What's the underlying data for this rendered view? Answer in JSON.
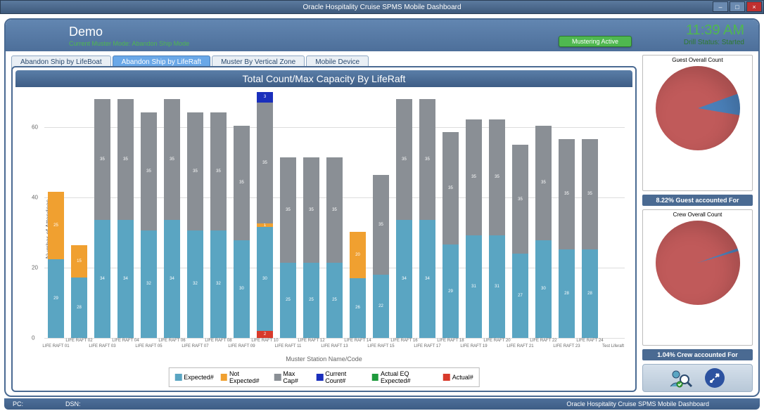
{
  "window": {
    "title": "Oracle Hospitality Cruise SPMS Mobile Dashboard"
  },
  "header": {
    "title": "Demo",
    "muster_mode": "Current Muster Mode: Abandon Ship Mode",
    "mustering_badge": "Mustering Active",
    "clock": "11:39 AM",
    "drill_status": "Drill Status: Started"
  },
  "tabs": [
    {
      "label": "Abandon Ship by LifeBoat",
      "active": false
    },
    {
      "label": "Abandon Ship by LifeRaft",
      "active": true
    },
    {
      "label": "Muster By Vertical Zone",
      "active": false
    },
    {
      "label": "Mobile Device",
      "active": false
    }
  ],
  "chart_data": {
    "type": "bar",
    "title": "Total Count/Max Capacity By LifeRaft",
    "xlabel": "Muster Station Name/Code",
    "ylabel": "Number of Attendees",
    "ylim": [
      0,
      70
    ],
    "y_ticks": [
      0,
      20,
      40,
      60
    ],
    "categories": [
      "LIFE RAFT 01",
      "LIFE RAFT 02",
      "LIFE RAFT 03",
      "LIFE RAFT 04",
      "LIFE RAFT 05",
      "LIFE RAFT 06",
      "LIFE RAFT 07",
      "LIFE RAFT 08",
      "LIFE RAFT 09",
      "LIFE RAFT 10",
      "LIFE RAFT 11",
      "LIFE RAFT 12",
      "LIFE RAFT 13",
      "LIFE RAFT 14",
      "LIFE RAFT 15",
      "LIFE RAFT 16",
      "LIFE RAFT 17",
      "LIFE RAFT 18",
      "LIFE RAFT 19",
      "LIFE RAFT 20",
      "LIFE RAFT 21",
      "LIFE RAFT 22",
      "LIFE RAFT 23",
      "LIFE RAFT 24",
      "Test Liferaft"
    ],
    "series": [
      {
        "name": "Expected#",
        "color": "#5aa5c2",
        "values": [
          29,
          28,
          34,
          34,
          32,
          34,
          32,
          32,
          30,
          30,
          25,
          25,
          25,
          26,
          22,
          34,
          34,
          29,
          31,
          31,
          27,
          30,
          28,
          28,
          0
        ]
      },
      {
        "name": "Not Expected#",
        "color": "#f0a030",
        "values": [
          25,
          15,
          0,
          0,
          0,
          0,
          0,
          0,
          0,
          1,
          0,
          0,
          0,
          20,
          0,
          0,
          0,
          0,
          0,
          0,
          0,
          0,
          0,
          0,
          0
        ]
      },
      {
        "name": "Max Cap#",
        "color": "#8a8f95",
        "values": [
          0,
          0,
          35,
          35,
          35,
          35,
          35,
          35,
          35,
          35,
          35,
          35,
          35,
          0,
          35,
          35,
          35,
          35,
          35,
          35,
          35,
          35,
          35,
          35,
          0
        ]
      },
      {
        "name": "Current Count#",
        "color": "#1a2fbc",
        "values": [
          0,
          0,
          0,
          0,
          0,
          0,
          0,
          0,
          0,
          3,
          0,
          0,
          0,
          0,
          0,
          0,
          0,
          0,
          0,
          0,
          0,
          0,
          0,
          0,
          0
        ]
      },
      {
        "name": "Actual EQ Expected#",
        "color": "#1e9a3c",
        "values": [
          0,
          0,
          0,
          0,
          0,
          0,
          0,
          0,
          0,
          0,
          0,
          0,
          0,
          0,
          0,
          0,
          0,
          0,
          0,
          0,
          0,
          0,
          0,
          0,
          0
        ]
      },
      {
        "name": "Actual#",
        "color": "#d83a2b",
        "values": [
          0,
          0,
          0,
          0,
          0,
          0,
          0,
          0,
          0,
          2,
          0,
          0,
          0,
          0,
          0,
          0,
          0,
          0,
          0,
          0,
          0,
          0,
          0,
          0,
          1
        ]
      }
    ]
  },
  "side_panels": {
    "guest": {
      "title": "Guest Overall Count",
      "accounted_pct": 8.22,
      "footer": "8.22% Guest accounted For"
    },
    "crew": {
      "title": "Crew Overall Count",
      "accounted_pct": 1.04,
      "footer": "1.04% Crew accounted For"
    }
  },
  "statusbar": {
    "pc": "PC:",
    "dsn": "DSN:",
    "app": "Oracle Hospitality Cruise SPMS Mobile Dashboard"
  }
}
